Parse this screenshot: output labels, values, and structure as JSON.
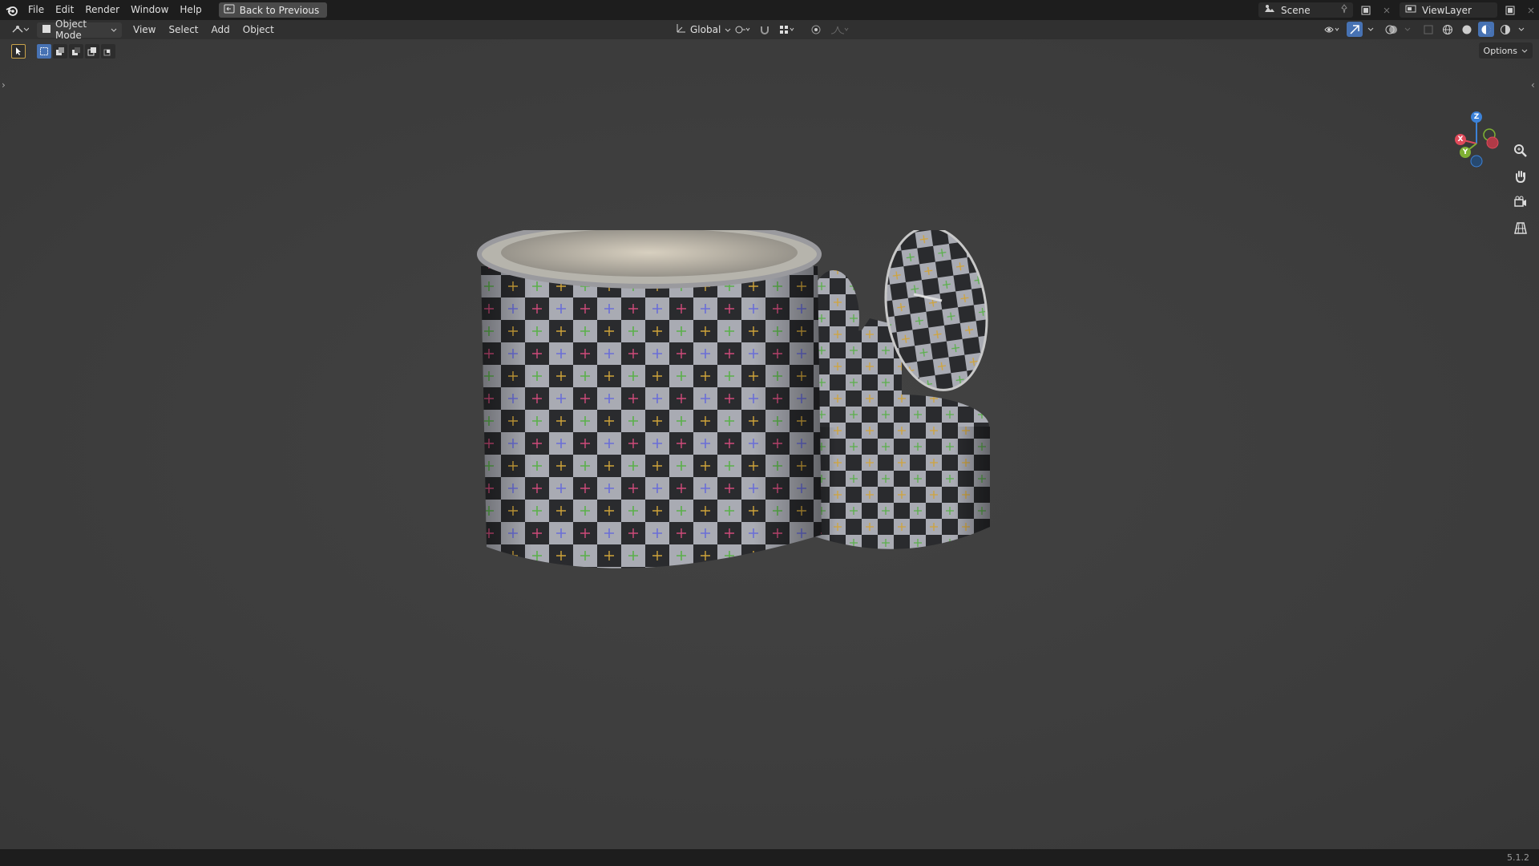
{
  "topbar": {
    "menus": [
      "File",
      "Edit",
      "Render",
      "Window",
      "Help"
    ],
    "back_button": "Back to Previous",
    "scene_name": "Scene",
    "view_layer": "ViewLayer"
  },
  "header": {
    "mode": "Object Mode",
    "menus": [
      "View",
      "Select",
      "Add",
      "Object"
    ],
    "transform_orientation": "Global"
  },
  "toolbar": {
    "options_label": "Options"
  },
  "gizmo": {
    "z_label": "Z",
    "x_label": "X",
    "y_label": "Y"
  },
  "status": {
    "version": "5.1.2"
  },
  "colors": {
    "accent": "#4772b3",
    "axis_x": "#e04a5a",
    "axis_y": "#7fb034",
    "axis_z": "#3c82d8"
  }
}
